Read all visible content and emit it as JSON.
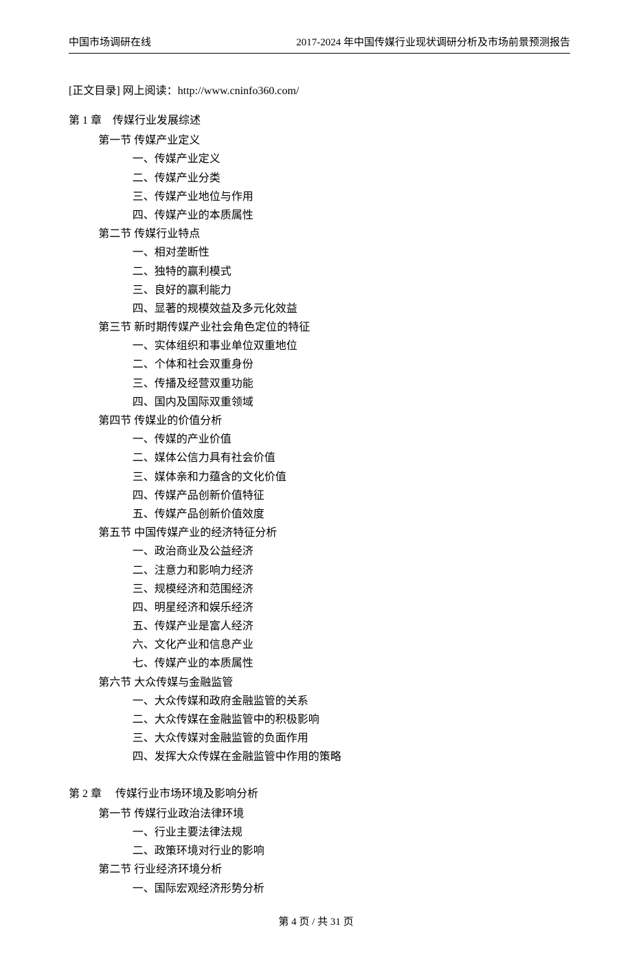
{
  "header": {
    "left": "中国市场调研在线",
    "right": "2017-2024 年中国传媒行业现状调研分析及市场前景预测报告"
  },
  "intro": "[正文目录] 网上阅读：http://www.cninfo360.com/",
  "chapters": [
    {
      "title": "第 1 章 传媒行业发展综述",
      "sections": [
        {
          "title": "第一节 传媒产业定义",
          "items": [
            "一、传媒产业定义",
            "二、传媒产业分类",
            "三、传媒产业地位与作用",
            "四、传媒产业的本质属性"
          ]
        },
        {
          "title": "第二节 传媒行业特点",
          "items": [
            "一、相对垄断性",
            "二、独特的赢利模式",
            "三、良好的赢利能力",
            "四、显著的规模效益及多元化效益"
          ]
        },
        {
          "title": "第三节 新时期传媒产业社会角色定位的特征",
          "items": [
            "一、实体组织和事业单位双重地位",
            "二、个体和社会双重身份",
            "三、传播及经营双重功能",
            "四、国内及国际双重领域"
          ]
        },
        {
          "title": "第四节 传媒业的价值分析",
          "items": [
            "一、传媒的产业价值",
            "二、媒体公信力具有社会价值",
            "三、媒体亲和力蕴含的文化价值",
            "四、传媒产品创新价值特征",
            "五、传媒产品创新价值效度"
          ]
        },
        {
          "title": "第五节 中国传媒产业的经济特征分析",
          "items": [
            "一、政治商业及公益经济",
            "二、注意力和影响力经济",
            "三、规模经济和范围经济",
            "四、明星经济和娱乐经济",
            "五、传媒产业是富人经济",
            "六、文化产业和信息产业",
            "七、传媒产业的本质属性"
          ]
        },
        {
          "title": "第六节 大众传媒与金融监管",
          "items": [
            "一、大众传媒和政府金融监管的关系",
            "二、大众传媒在金融监管中的积极影响",
            "三、大众传媒对金融监管的负面作用",
            "四、发挥大众传媒在金融监管中作用的策略"
          ]
        }
      ]
    },
    {
      "title": "第 2 章  传媒行业市场环境及影响分析",
      "sections": [
        {
          "title": "第一节 传媒行业政治法律环境",
          "items": [
            "一、行业主要法律法规",
            "二、政策环境对行业的影响"
          ]
        },
        {
          "title": "第二节 行业经济环境分析",
          "items": [
            "一、国际宏观经济形势分析"
          ]
        }
      ]
    }
  ],
  "footer": {
    "text": "第 4 页 / 共 31 页"
  }
}
